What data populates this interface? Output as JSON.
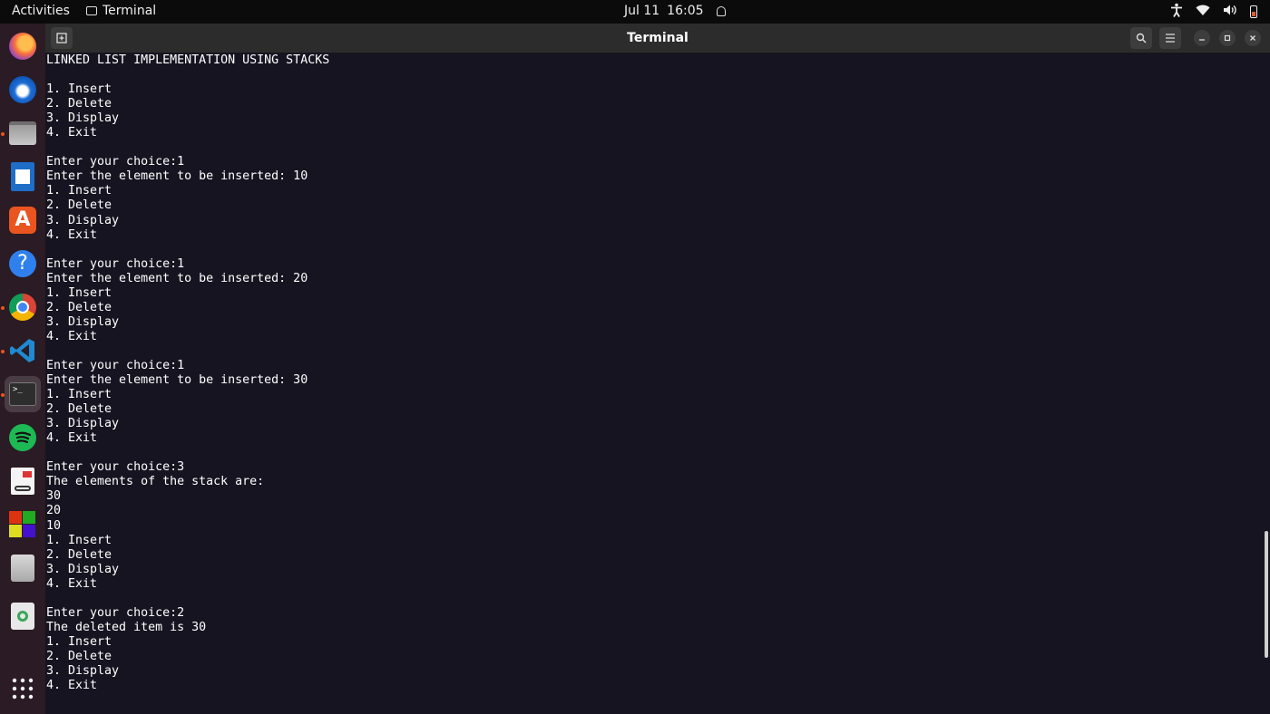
{
  "topbar": {
    "activities": "Activities",
    "app_name": "Terminal",
    "date": "Jul 11",
    "time": "16:05"
  },
  "window": {
    "title": "Terminal"
  },
  "dock": {
    "items": [
      "firefox-icon",
      "thunderbird-icon",
      "files-icon",
      "writer-icon",
      "app-center-icon",
      "help-icon",
      "chrome-icon",
      "vscode-icon",
      "terminal-icon",
      "spotify-icon",
      "document-viewer-icon",
      "color-blocks-icon",
      "storage-icon",
      "trash-icon",
      "app-grid-icon"
    ]
  },
  "terminal": {
    "lines": [
      "LINKED LIST IMPLEMENTATION USING STACKS",
      "",
      "1. Insert",
      "2. Delete",
      "3. Display",
      "4. Exit",
      "",
      "Enter your choice:1",
      "Enter the element to be inserted: 10",
      "1. Insert",
      "2. Delete",
      "3. Display",
      "4. Exit",
      "",
      "Enter your choice:1",
      "Enter the element to be inserted: 20",
      "1. Insert",
      "2. Delete",
      "3. Display",
      "4. Exit",
      "",
      "Enter your choice:1",
      "Enter the element to be inserted: 30",
      "1. Insert",
      "2. Delete",
      "3. Display",
      "4. Exit",
      "",
      "Enter your choice:3",
      "The elements of the stack are:",
      "30",
      "20",
      "10",
      "1. Insert",
      "2. Delete",
      "3. Display",
      "4. Exit",
      "",
      "Enter your choice:2",
      "The deleted item is 30",
      "1. Insert",
      "2. Delete",
      "3. Display",
      "4. Exit"
    ]
  }
}
